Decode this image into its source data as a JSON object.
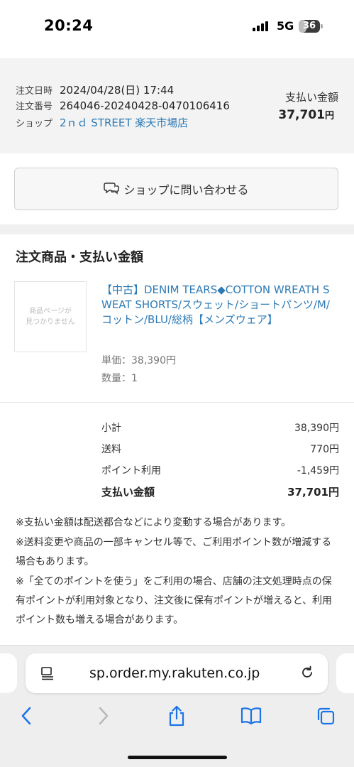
{
  "status_bar": {
    "time": "20:24",
    "network": "5G",
    "battery": "36",
    "battery_level": 0.36
  },
  "order": {
    "date_label": "注文日時",
    "date_value": "2024/04/28(日) 17:44",
    "number_label": "注文番号",
    "number_value": "264046-20240428-0470106416",
    "shop_label": "ショップ",
    "shop_value": "2ｎｄ STREET 楽天市場店",
    "pay_label": "支払い金額",
    "pay_amount": "37,701",
    "pay_yen": "円"
  },
  "contact_button": {
    "icon": "chat-bubbles-icon",
    "label": "ショップに問い合わせる"
  },
  "items_section": {
    "title": "注文商品・支払い金額",
    "thumbnail_placeholder_line1": "商品ページが",
    "thumbnail_placeholder_line2": "見つかりません",
    "product_name": "【中古】DENIM TEARS◆COTTON WREATH SWEAT SHORTS/スウェット/ショートパンツ/M/コットン/BLU/総柄【メンズウェア】",
    "unit_price": "単価：38,390円",
    "quantity": "数量：1"
  },
  "totals": [
    {
      "label": "小計",
      "value": "38,390円"
    },
    {
      "label": "送料",
      "value": "770円"
    },
    {
      "label": "ポイント利用",
      "value": "-1,459円"
    },
    {
      "label": "支払い金額",
      "value": "37,701円"
    }
  ],
  "notes": [
    "※支払い金額は配送都合などにより変動する場合があります。",
    "※送料変更や商品の一部キャンセル等で、ご利用ポイント数が増減する場合もあります。",
    "※「全てのポイントを使う」をご利用の場合、店舗の注文処理時点の保有ポイントが利用対象となり、注文後に保有ポイントが増えると、利用ポイント数も増える場合があります。"
  ],
  "browser": {
    "url": "sp.order.my.rakuten.co.jp",
    "accent_color": "#1a73e8",
    "toolbar": [
      "back-icon",
      "forward-icon",
      "share-icon",
      "bookmarks-icon",
      "tabs-icon"
    ]
  },
  "colors": {
    "link": "#2d7bb6",
    "summary_bg": "#f3f3f3",
    "toolbar_blue": "#1a73e8"
  }
}
